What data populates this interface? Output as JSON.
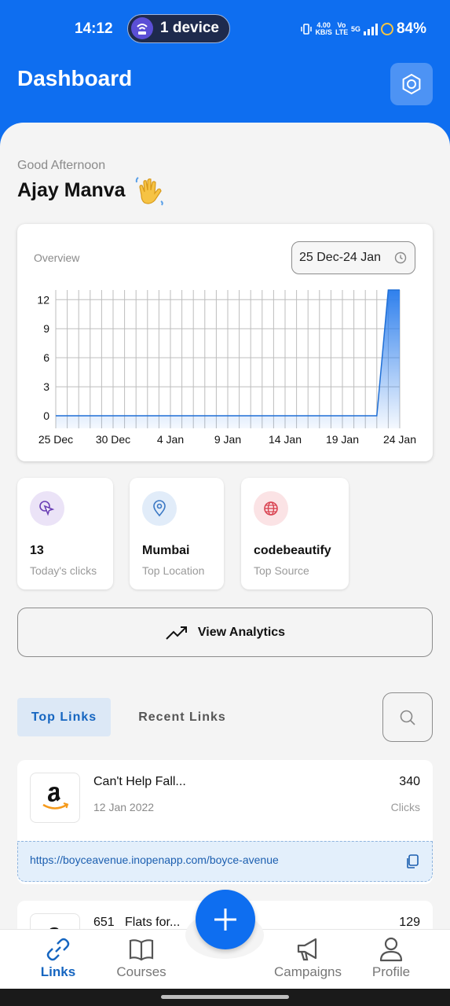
{
  "status_bar": {
    "time": "14:12",
    "device_pill": "1 device",
    "speed_value": "4.00",
    "speed_unit": "KB/S",
    "volte": "Vo LTE",
    "network": "5G",
    "battery": "84%"
  },
  "header": {
    "title": "Dashboard",
    "settings_icon": "gear-icon"
  },
  "greeting": {
    "salutation": "Good Afternoon",
    "name": "Ajay Manva",
    "emoji_icon": "waving-hand-icon"
  },
  "overview": {
    "label": "Overview",
    "date_range": "25 Dec-24 Jan"
  },
  "chart_data": {
    "type": "area",
    "title": "",
    "x_tick_labels": [
      "25 Dec",
      "30 Dec",
      "4 Jan",
      "9 Jan",
      "14 Jan",
      "19 Jan",
      "24 Jan"
    ],
    "y_ticks": [
      0,
      3,
      9,
      6,
      12
    ],
    "ylim": [
      0,
      13
    ],
    "x": [
      "25 Dec",
      "26 Dec",
      "27 Dec",
      "28 Dec",
      "29 Dec",
      "30 Dec",
      "31 Dec",
      "1 Jan",
      "2 Jan",
      "3 Jan",
      "4 Jan",
      "5 Jan",
      "6 Jan",
      "7 Jan",
      "8 Jan",
      "9 Jan",
      "10 Jan",
      "11 Jan",
      "12 Jan",
      "13 Jan",
      "14 Jan",
      "15 Jan",
      "16 Jan",
      "17 Jan",
      "18 Jan",
      "19 Jan",
      "20 Jan",
      "21 Jan",
      "22 Jan",
      "23 Jan",
      "24 Jan"
    ],
    "series": [
      {
        "values": [
          0,
          0,
          0,
          0,
          0,
          0,
          0,
          0,
          0,
          0,
          0,
          0,
          0,
          0,
          0,
          0,
          0,
          0,
          0,
          0,
          0,
          0,
          0,
          0,
          0,
          0,
          0,
          0,
          0,
          13,
          13
        ]
      }
    ],
    "xlabel": "",
    "ylabel": "",
    "grid": true,
    "line_color": "#1f6fd6",
    "fill_color": "#2f80ed"
  },
  "stats": [
    {
      "value": "13",
      "label": "Today's clicks",
      "icon": "cursor-click-icon",
      "tint": "#ebe3f7"
    },
    {
      "value": "Mumbai",
      "label": "Top Location",
      "icon": "map-pin-icon",
      "tint": "#e1ecf9"
    },
    {
      "value": "codebeautify",
      "label": "Top Source",
      "icon": "globe-icon",
      "tint": "#fbe3e5"
    }
  ],
  "analytics_button": {
    "label": "View Analytics",
    "icon": "trending-up-icon"
  },
  "tabs": {
    "top_links": "Top Links",
    "recent_links": "Recent Links"
  },
  "links": [
    {
      "title": "Can't Help Fall...",
      "date": "12 Jan 2022",
      "clicks": "340",
      "clicks_label": "Clicks",
      "url": "https://boyceavenue.inopenapp.com/boyce-avenue",
      "logo": "amazon-logo"
    },
    {
      "title": "651   Flats for...",
      "clicks": "129",
      "logo": "amazon-logo"
    }
  ],
  "bottom_nav": [
    {
      "label": "Links",
      "icon": "link-icon",
      "active": true
    },
    {
      "label": "Courses",
      "icon": "book-icon",
      "active": false
    },
    {
      "label": "Campaigns",
      "icon": "megaphone-icon",
      "active": false
    },
    {
      "label": "Profile",
      "icon": "user-icon",
      "active": false
    }
  ],
  "colors": {
    "primary": "#0e6ef0",
    "active_tab_text": "#1565c0"
  }
}
